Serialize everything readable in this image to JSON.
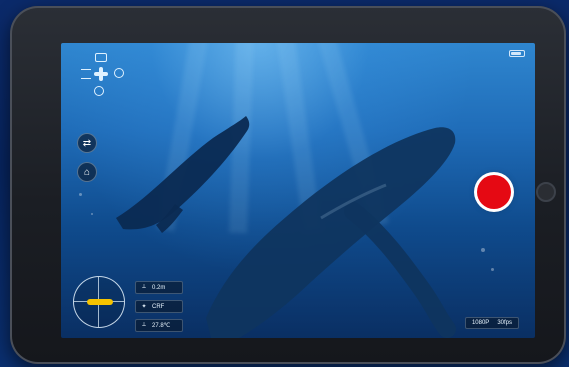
{
  "status_bar": {
    "items": [
      "",
      "",
      "",
      ""
    ],
    "battery_icon": "battery-icon"
  },
  "controls": {
    "camera_icon": "camera-icon",
    "dpad_icon": "dpad-icon",
    "settings_icon": "circle-icon",
    "mode_icon": "circle-icon",
    "swap_icon": "swap-icon",
    "home_icon": "home-icon",
    "record_button_color": "#e50913"
  },
  "telemetry": {
    "depth": "0.2m",
    "heading": "CRF",
    "temperature": "27.8℃"
  },
  "video": {
    "resolution": "1080P",
    "fps": "30fps"
  }
}
